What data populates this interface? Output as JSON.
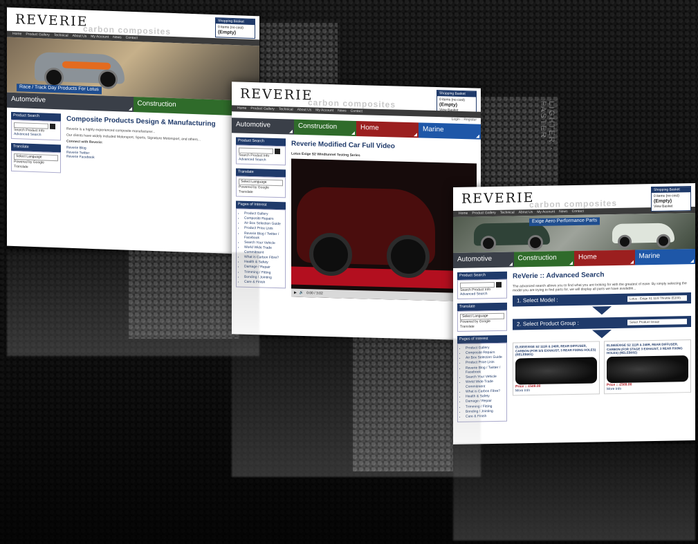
{
  "brand": {
    "logo": "REVERIE",
    "tagline": "carbon composites"
  },
  "side_text": "LIGHTER · FASTER",
  "cart": {
    "title": "Shopping Basket",
    "items": "0 items (no cost)",
    "empty": "(Empty)",
    "view": "View Basket"
  },
  "nav": [
    "Home",
    "Product Gallery",
    "Technical",
    "About Us",
    "My Account",
    "News",
    "Contact"
  ],
  "login": "Login :: Register",
  "categories": [
    "Automotive",
    "Construction",
    "Home",
    "Marine"
  ],
  "sidebar": {
    "search_title": "Product Search",
    "search_check": "Search Product Info",
    "advanced": "Advanced Search",
    "translate_title": "Translate",
    "select_language": "Select Language",
    "powered": "Powered by Google Translate",
    "poi_title": "Pages of Interest",
    "poi": [
      "Product Gallery",
      "Composite Repairs",
      "Air Box Selection Guide",
      "Product Price Lists",
      "Reverie Blog / Twitter / Facebook",
      "Search Your Vehicle",
      "World Wide Trade Commitment",
      "What is Carbon Fibre?",
      "Health & Safety",
      "Damage / Repair",
      "Trimming / Fitting",
      "Bonding / Jointing",
      "Care & Finish"
    ]
  },
  "page1": {
    "hero_label": "Race / Track Day Products For Lotus",
    "heading": "Composite Products Design & Manufacturing",
    "para1": "Reverie is a highly experienced composite manufacturer...",
    "para2": "Our clients have widely included Motorsport, Sports, Signature Motorsport, and others...",
    "connect": "Connect with Reverie:",
    "links": [
      "Reverie Blog",
      "Reverie Twitter",
      "Reverie Facebook"
    ]
  },
  "page2": {
    "heading": "Reverie Modified Car Full Video",
    "subtitle": "Lotus Exige S2 Windtunnel Testing Series",
    "time": "0:00 / 3:02"
  },
  "page3": {
    "hero_label": "Exige Aero Performance Parts",
    "heading": "ReVerie :: Advanced Search",
    "intro": "The advanced search allows you to find what you are looking for with the greatest of ease. By simply selecting the model you are trying to find parts for, we will display all parts we have available...",
    "step1": "1. Select Model :",
    "step1_val": "Lotus - Exige S1 11/8 Throttle (E200)",
    "step2": "2. Select Product Group :",
    "step2_val": "Select Product Group",
    "products": [
      {
        "title": "ELISE/EXIGE S2 111R & 240R, REAR DIFFUSER, CARBON (FOR S/S EXHAUST, 3 REAR FIXING HOLES) (RELEB001)",
        "price": "Price :: £509.00"
      },
      {
        "title": "ELISE/EXIGE S2 111R & 240R, REAR DIFFUSER, CARBON (FOR STAGE 3 EXHAUST, 3 REAR FIXING HOLES) (RELEB002)",
        "price": "Price :: £509.00"
      }
    ],
    "more_info": "More Info"
  }
}
